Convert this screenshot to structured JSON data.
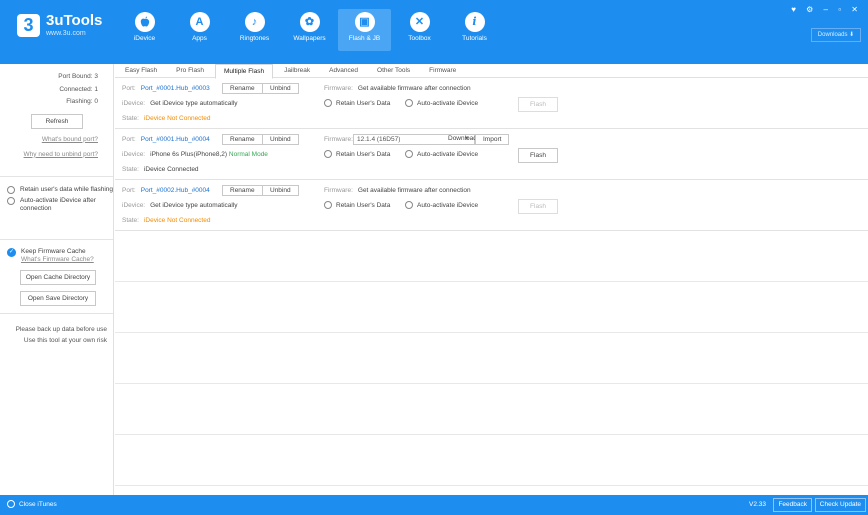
{
  "app": {
    "name": "3uTools",
    "url": "www.3u.com",
    "logo_glyph": "3"
  },
  "nav": [
    {
      "label": "iDevice",
      "icon": "apple-icon",
      "glyph": ""
    },
    {
      "label": "Apps",
      "icon": "apps-icon",
      "glyph": "A"
    },
    {
      "label": "Ringtones",
      "icon": "bell-icon",
      "glyph": "♪"
    },
    {
      "label": "Wallpapers",
      "icon": "wallpaper-icon",
      "glyph": "✿"
    },
    {
      "label": "Flash & JB",
      "icon": "box-icon",
      "glyph": "▣"
    },
    {
      "label": "Toolbox",
      "icon": "toolbox-icon",
      "glyph": "✕"
    },
    {
      "label": "Tutorials",
      "icon": "info-icon",
      "glyph": "i"
    }
  ],
  "window_controls": "♥ ⚙ – ▫ ✕",
  "downloads_label": "Downloads ⬇",
  "sidebar": {
    "port_bound": "Port Bound: 3",
    "connected": "Connected: 1",
    "flashing": "Flashing: 0",
    "refresh": "Refresh",
    "whats_bound": "What's bound port?",
    "why_unbind": "Why need to unbind port?",
    "retain_opt": "Retain user's data while flashing",
    "auto_opt": "Auto-activate iDevice after connection",
    "keep_cache": "Keep Firmware Cache",
    "whats_cache": "What's Firmware Cache?",
    "open_cache": "Open Cache Directory",
    "open_save": "Open Save Directory",
    "note": "Please back up data before use Use this tool at your own risk"
  },
  "tabs": [
    "Easy Flash",
    "Pro Flash",
    "Multiple Flash",
    "Jailbreak",
    "Advanced",
    "Other Tools",
    "Firmware"
  ],
  "active_tab": "Multiple Flash",
  "labels": {
    "port": "Port:",
    "idevice": "iDevice:",
    "state": "State:",
    "firmware": "Firmware:",
    "rename": "Rename",
    "unbind": "Unbind",
    "retain": "Retain User's Data",
    "auto": "Auto-activate iDevice",
    "flash": "Flash",
    "download": "Download",
    "import": "Import"
  },
  "devices": [
    {
      "port": "Port_#0001.Hub_#0003",
      "idevice": "Get iDevice type automatically",
      "mode": "",
      "state": "iDevice Not Connected",
      "firmware": "Get available firmware after connection"
    },
    {
      "port": "Port_#0001.Hub_#0004",
      "idevice": "iPhone 6s Plus(iPhone8,2)",
      "mode": "Normal Mode",
      "state": "iDevice Connected",
      "firmware": "12.1.4 (16D57)"
    },
    {
      "port": "Port_#0002.Hub_#0004",
      "idevice": "Get iDevice type automatically",
      "mode": "",
      "state": "iDevice Not Connected",
      "firmware": "Get available firmware after connection"
    }
  ],
  "bottom": {
    "close_itunes": "Close iTunes",
    "version": "V2.33",
    "feedback": "Feedback",
    "check_update": "Check Update"
  },
  "colors": {
    "accent": "#1d8ef0",
    "link": "#1d73d0",
    "warning": "#f08c00",
    "ok": "#34a853"
  }
}
